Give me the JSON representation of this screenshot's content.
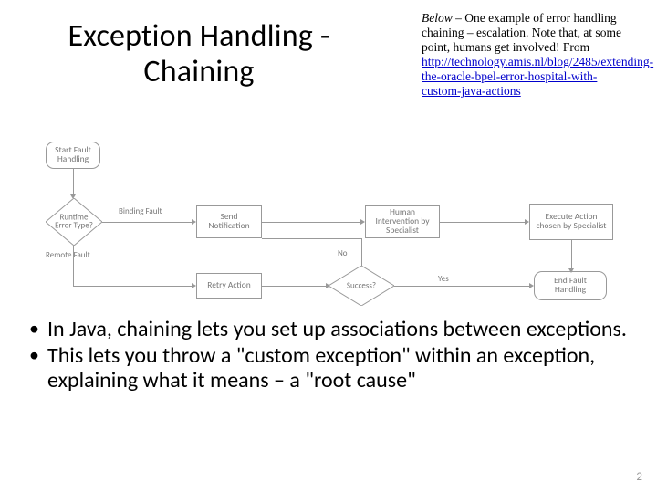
{
  "title": "Exception Handling - Chaining",
  "note": {
    "below_label": "Below",
    "intro": " – One example of error handling chaining – escalation.  Note that, at some point, humans get involved!  From ",
    "link_text": "http://technology.amis.nl/blog/2485/extending-the-oracle-bpel-error-hospital-with-custom-java-actions",
    "link_href": "http://technology.amis.nl/blog/2485/extending-the-oracle-bpel-error-hospital-with-custom-java-actions"
  },
  "bullets": [
    "In Java, chaining lets you set up associations between exceptions.",
    "This lets you throw a \"custom exception\" within an exception, explaining what it means – a \"root cause\""
  ],
  "page_number": "2",
  "flowchart": {
    "start": "Start Fault Handling",
    "decision_error_type": "Runtime Error Type?",
    "branch_binding": "Binding Fault",
    "branch_remote": "Remote Fault",
    "send_notification": "Send Notification",
    "human_intervention": "Human Intervention by Specialist",
    "execute_action": "Execute Action chosen by Specialist",
    "retry_action": "Retry Action",
    "decision_success": "Success?",
    "yes": "Yes",
    "no": "No",
    "end": "End Fault Handling"
  }
}
